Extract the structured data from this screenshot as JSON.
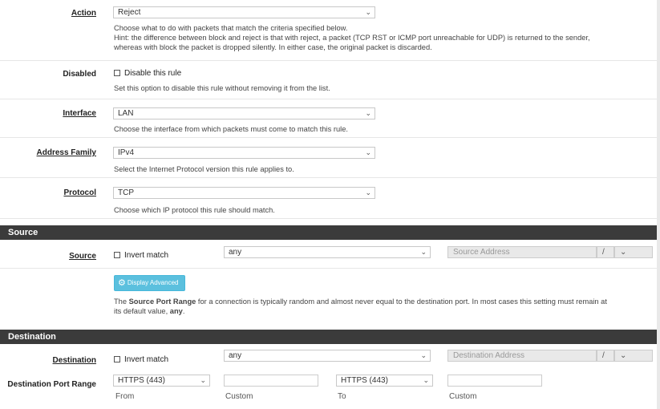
{
  "action": {
    "label": "Action",
    "value": "Reject",
    "help1": "Choose what to do with packets that match the criteria specified below.",
    "help2": "Hint: the difference between block and reject is that with reject, a packet (TCP RST or ICMP port unreachable for UDP) is returned to the sender,",
    "help3": "whereas with block the packet is dropped silently. In either case, the original packet is discarded."
  },
  "disabled": {
    "label": "Disabled",
    "checkbox_label": "Disable this rule",
    "help": "Set this option to disable this rule without removing it from the list."
  },
  "interface": {
    "label": "Interface",
    "value": "LAN",
    "help": "Choose the interface from which packets must come to match this rule."
  },
  "address_family": {
    "label": "Address Family",
    "value": "IPv4",
    "help": "Select the Internet Protocol version this rule applies to."
  },
  "protocol": {
    "label": "Protocol",
    "value": "TCP",
    "help": "Choose which IP protocol this rule should match."
  },
  "source_section": {
    "title": "Source"
  },
  "source": {
    "label": "Source",
    "invert_label": "Invert match",
    "type_value": "any",
    "address_placeholder": "Source Address",
    "slash": "/",
    "advanced_button": "Display Advanced",
    "help_prefix": "The ",
    "help_bold": "Source Port Range",
    "help_mid": " for a connection is typically random and almost never equal to the destination port. In most cases this setting must remain at",
    "help_line2_prefix": "its default value, ",
    "help_line2_bold": "any",
    "help_line2_suffix": "."
  },
  "destination_section": {
    "title": "Destination"
  },
  "destination": {
    "label": "Destination",
    "invert_label": "Invert match",
    "type_value": "any",
    "address_placeholder": "Destination Address",
    "slash": "/"
  },
  "port_range": {
    "label": "Destination Port Range",
    "from_value": "HTTPS (443)",
    "from_caption": "From",
    "custom_caption": "Custom",
    "to_value": "HTTPS (443)",
    "to_caption": "To",
    "custom_caption2": "Custom"
  },
  "icons": {
    "chevron": "chevron-down-icon",
    "gear": "gear-icon",
    "checkbox": "checkbox-icon"
  }
}
